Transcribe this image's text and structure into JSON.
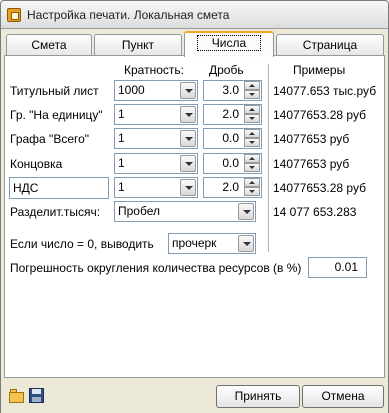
{
  "window": {
    "title": "Настройка печати. Локальная смета"
  },
  "tabs": [
    {
      "label": "Смета"
    },
    {
      "label": "Пункт"
    },
    {
      "label": "Числа"
    },
    {
      "label": "Страница"
    }
  ],
  "headers": {
    "multiplicity": "Кратность:",
    "fraction": "Дробь",
    "examples": "Примеры"
  },
  "rows": [
    {
      "label": "Титульный лист",
      "multiplicity": "1000",
      "fraction": "3.0",
      "example": "14077.653 тыс.руб"
    },
    {
      "label": "Гр. \"На единицу\"",
      "multiplicity": "1",
      "fraction": "2.0",
      "example": "14077653.28 руб"
    },
    {
      "label": "Графа \"Всего\"",
      "multiplicity": "1",
      "fraction": "0.0",
      "example": "14077653 руб"
    },
    {
      "label": "Концовка",
      "multiplicity": "1",
      "fraction": "0.0",
      "example": "14077653 руб"
    },
    {
      "label": "НДС",
      "multiplicity": "1",
      "fraction": "2.0",
      "example": "14077653.28 руб"
    }
  ],
  "separator": {
    "label": "Разделит.тысяч:",
    "value": "Пробел",
    "example": "14 077 653.283"
  },
  "zero_output": {
    "label": "Если число = 0, выводить",
    "value": "прочерк"
  },
  "rounding": {
    "label": "Погрешность округления количества ресурсов (в %)",
    "value": "0.01"
  },
  "buttons": {
    "accept": "Принять",
    "cancel": "Отмена"
  },
  "icons": [
    "folder-icon",
    "save-icon",
    "chevron-down-icon"
  ]
}
